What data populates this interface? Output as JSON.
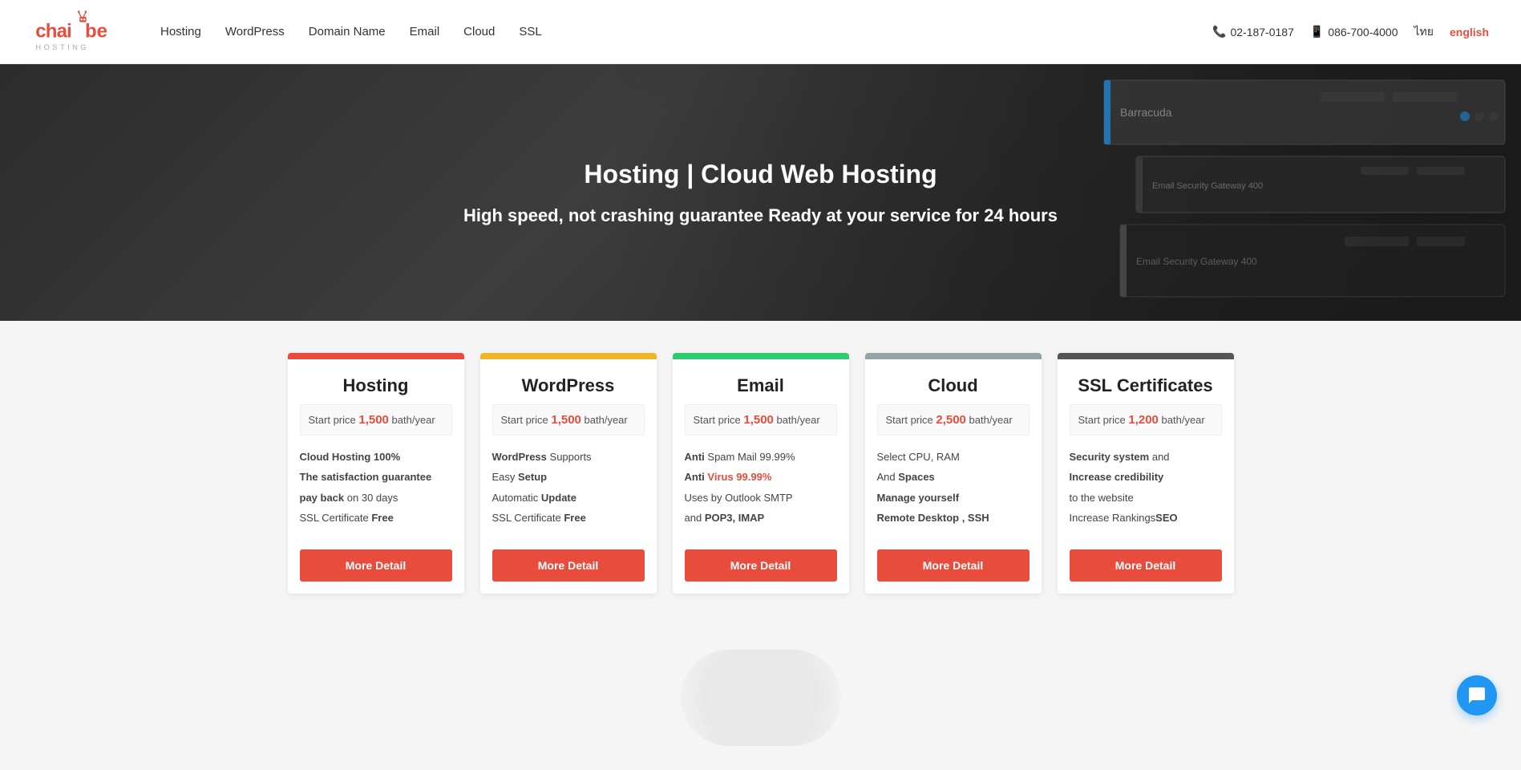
{
  "header": {
    "logo_alt": "Chaibe Hosting",
    "nav": {
      "items": [
        {
          "label": "Hosting",
          "id": "hosting"
        },
        {
          "label": "WordPress",
          "id": "wordpress"
        },
        {
          "label": "Domain Name",
          "id": "domain"
        },
        {
          "label": "Email",
          "id": "email"
        },
        {
          "label": "Cloud",
          "id": "cloud"
        },
        {
          "label": "SSL",
          "id": "ssl"
        }
      ]
    },
    "contact": {
      "phone": "02-187-0187",
      "mobile": "086-700-4000",
      "lang_thai": "ไทย",
      "lang_english": "english"
    }
  },
  "hero": {
    "title": "Hosting | Cloud Web Hosting",
    "subtitle": "High speed, not crashing guarantee Ready at your service for 24 hours"
  },
  "cards": [
    {
      "id": "hosting",
      "title": "Hosting",
      "bar_color": "#e74c3c",
      "price_num": "1,500",
      "price_text": "bath/year",
      "features": [
        {
          "text": "Cloud Hosting 100%",
          "bold": "Cloud Hosting 100%",
          "type": "bold"
        },
        {
          "text": "The satisfaction guarantee",
          "bold": "The satisfaction guarantee",
          "type": "bold"
        },
        {
          "text": "pay back on 30 days",
          "prefix": "pay back",
          "suffix": "on 30 days"
        },
        {
          "text": "SSL Certificate Free",
          "suffix_bold": "Free"
        }
      ],
      "features_display": [
        "Cloud Hosting 100%",
        "The satisfaction guarantee",
        "pay back on 30 days",
        "SSL Certificate Free"
      ],
      "btn_label": "More Detail"
    },
    {
      "id": "wordpress",
      "title": "WordPress",
      "bar_color": "#f39c12",
      "price_num": "1,500",
      "price_text": "bath/year",
      "features_display": [
        "WordPress Supports",
        "Easy Setup",
        "Automatic Update",
        "SSL Certificate Free"
      ],
      "features_bold": [
        "WordPress",
        "Setup",
        "Update",
        "Free"
      ],
      "btn_label": "More Detail"
    },
    {
      "id": "email",
      "title": "Email",
      "bar_color": "#2ecc71",
      "price_num": "1,500",
      "price_text": "bath/year",
      "features_display": [
        "Anti Spam Mail 99.99%",
        "Anti Virus 99.99%",
        "Uses by Outlook SMTP",
        "and POP3, IMAP"
      ],
      "btn_label": "More Detail"
    },
    {
      "id": "cloud",
      "title": "Cloud",
      "bar_color": "#95a5a6",
      "price_num": "2,500",
      "price_text": "bath/year",
      "features_display": [
        "Select CPU, RAM",
        "And Spaces",
        "Manage yourself",
        "Remote Desktop , SSH"
      ],
      "btn_label": "More Detail"
    },
    {
      "id": "ssl",
      "title": "SSL Certificates",
      "bar_color": "#555",
      "price_num": "1,200",
      "price_text": "bath/year",
      "features_display": [
        "Security system and",
        "Increase credibility",
        "to the website",
        "Increase RankingsSEO"
      ],
      "btn_label": "More Detail"
    }
  ],
  "chat": {
    "label": "Chat"
  }
}
